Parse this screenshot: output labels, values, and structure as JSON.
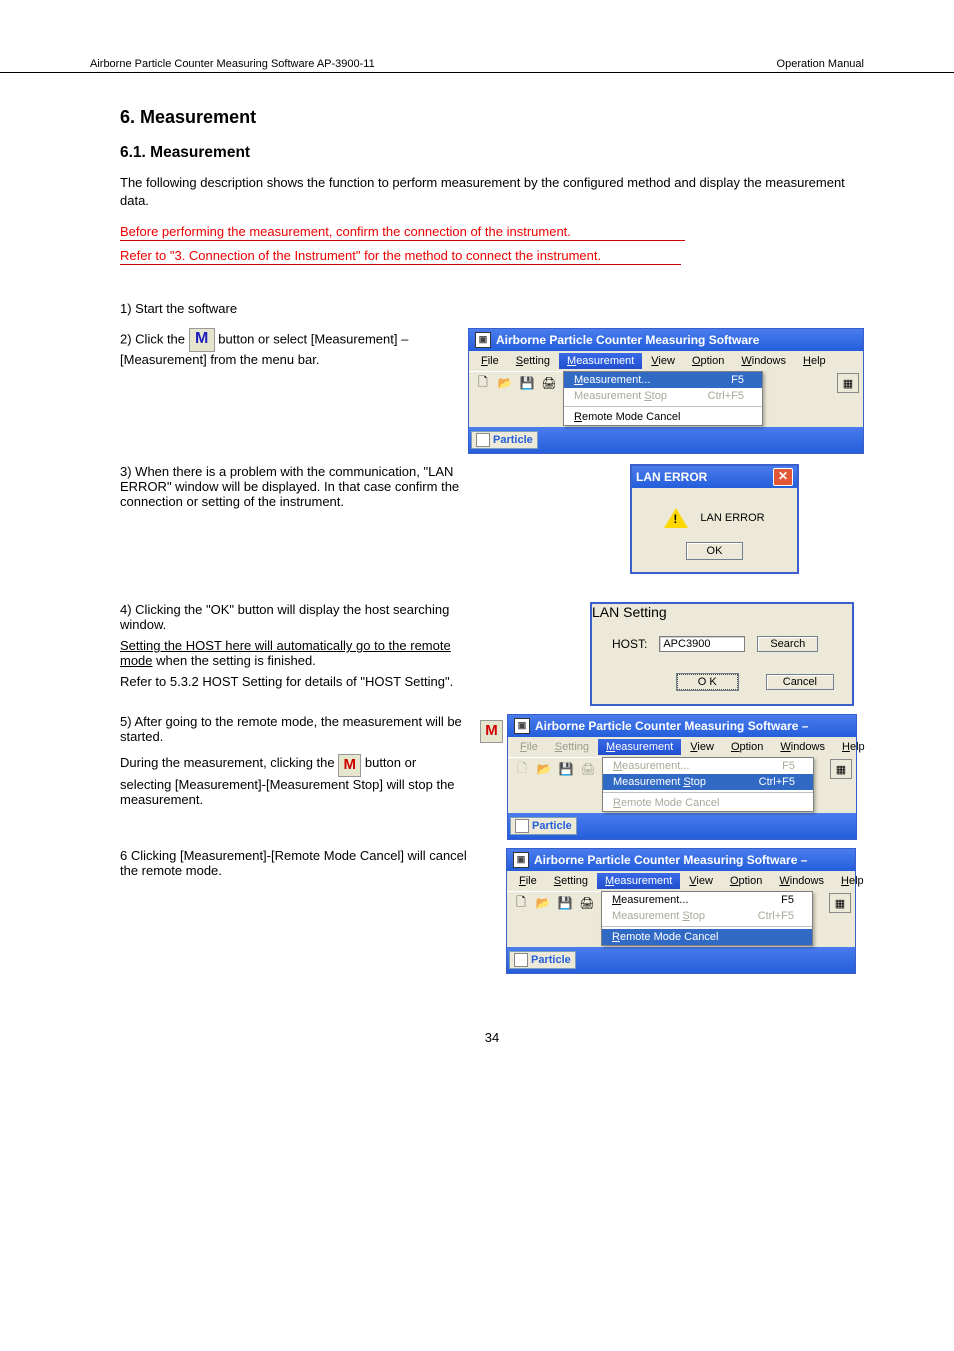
{
  "header": {
    "left": "Airborne Particle Counter Measuring Software AP-3900-11",
    "right": "Operation Manual"
  },
  "section": {
    "number": "6.",
    "title": "Measurement"
  },
  "sub": "6.1. Measurement",
  "para": "The following description shows the function to perform measurement by the configured method and display the measurement data.",
  "caution1": "Before performing the measurement, confirm the connection of the instrument.",
  "caution2": "Refer to \"3. Connection of the Instrument\" for the method to connect the instrument.",
  "step1": "1) Start the software",
  "step2_prefix": "2) Click the ",
  "step2_suffix": " button or select [Measurement] – [Measurement] from the menu bar.",
  "m_icon": "M",
  "step3": "3) When there is a problem with the communication, \"LAN ERROR\" window will be displayed. In that case confirm the connection or setting of the instrument.",
  "step4_prefix": "4) Clicking the \"",
  "step4_ok": "OK",
  "step4_suffix": "\" button will display the host searching window.",
  "step4a": "Setting the HOST here will automatically go to the remote mode",
  "step4a_when": " when the setting is finished.",
  "step4b": "Refer to ",
  "step4b_link": "5.3.2 HOST Setting",
  "step4b_suffix": " for details of \"HOST Setting\".",
  "step5": "5) After going to the remote mode, the measurement will be started.",
  "step5_extra": "During the measurement, clicking the",
  "step5_icon": "M",
  "step5_extra2": " button or selecting [Measurement]-[Measurement Stop] will stop the measurement.",
  "step6": "6  Clicking [Measurement]-[Remote Mode Cancel] will cancel the remote mode.",
  "window_title": "Airborne Particle Counter Measuring Software",
  "window_title_dash": "Airborne Particle Counter Measuring Software –",
  "menu": {
    "file": "File",
    "setting": "Setting",
    "measurement": "Measurement",
    "view": "View",
    "option": "Option",
    "windows": "Windows",
    "help": "Help"
  },
  "menuitems": {
    "measurement": "Measurement...",
    "f5": "F5",
    "stop": "Measurement Stop",
    "ctrlf5": "Ctrl+F5",
    "remote_cancel": "Remote Mode Cancel"
  },
  "particle_tab": "Particle",
  "lan_error": {
    "title": "LAN ERROR",
    "text": "LAN ERROR",
    "ok": "OK"
  },
  "lan_setting": {
    "title": "LAN Setting",
    "host_label": "HOST:",
    "host_value": "APC3900",
    "search": "Search",
    "ok": "O K",
    "cancel": "Cancel"
  },
  "page_number": "34"
}
